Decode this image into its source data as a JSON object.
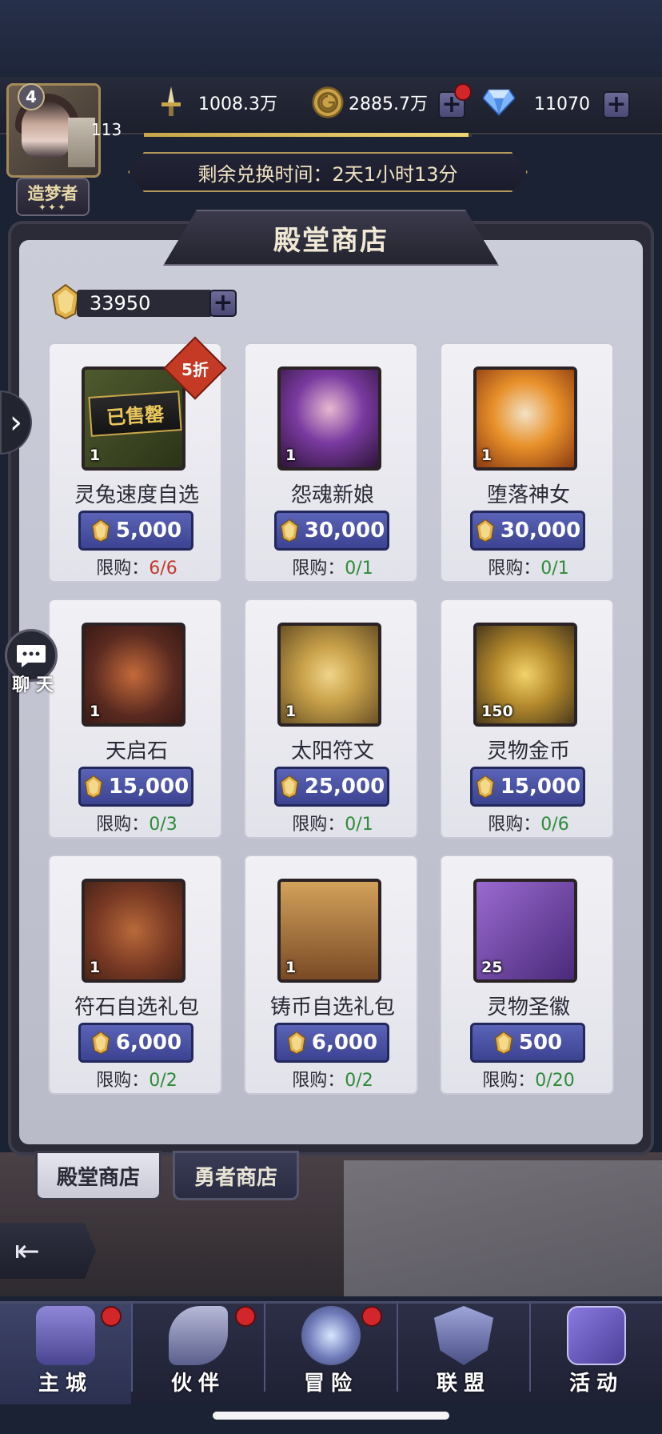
{
  "player": {
    "level": "4",
    "vip": "113",
    "title": "造梦者",
    "title_stars": "✦✦✦"
  },
  "resources": {
    "power": "1008.3万",
    "gold": "2885.7万",
    "diamonds": "11070"
  },
  "timer": "剩余兑换时间：2天1小时13分",
  "shop": {
    "title": "殿堂商店",
    "currency_balance": "33950",
    "limit_label": "限购：",
    "items": [
      {
        "name": "灵兔速度自选",
        "count": "1",
        "price": "5,000",
        "limit": "6/6",
        "status": "已售罄",
        "discount": "5折"
      },
      {
        "name": "怨魂新娘",
        "count": "1",
        "price": "30,000",
        "limit": "0/1"
      },
      {
        "name": "堕落神女",
        "count": "1",
        "price": "30,000",
        "limit": "0/1"
      },
      {
        "name": "天启石",
        "count": "1",
        "price": "15,000",
        "limit": "0/3"
      },
      {
        "name": "太阳符文",
        "count": "1",
        "price": "25,000",
        "limit": "0/1"
      },
      {
        "name": "灵物金币",
        "count": "150",
        "price": "15,000",
        "limit": "0/6"
      },
      {
        "name": "符石自选礼包",
        "count": "1",
        "price": "6,000",
        "limit": "0/2"
      },
      {
        "name": "铸币自选礼包",
        "count": "1",
        "price": "6,000",
        "limit": "0/2"
      },
      {
        "name": "灵物圣徽",
        "count": "25",
        "price": "500",
        "limit": "0/20"
      }
    ]
  },
  "tabs": [
    "殿堂商店",
    "勇者商店"
  ],
  "chat_label": "聊 天",
  "nav": [
    "主城",
    "伙伴",
    "冒险",
    "联盟",
    "活动"
  ],
  "colors": {
    "accent": "#4a51a4",
    "limit_ok": "#2f8a3a",
    "limit_full": "#c23b2f"
  }
}
